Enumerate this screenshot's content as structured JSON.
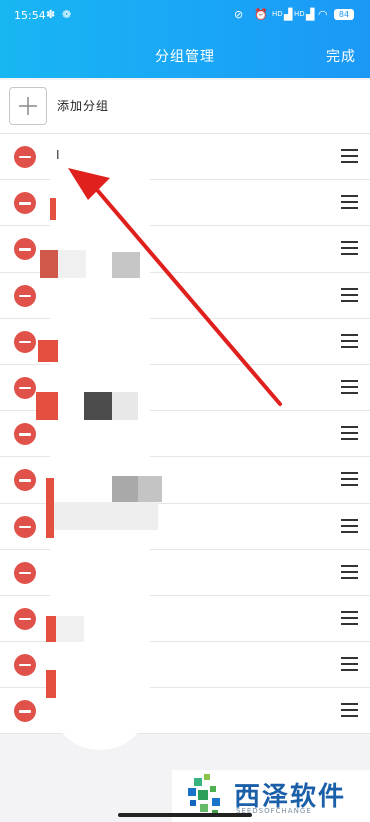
{
  "status_bar": {
    "time": "15:54",
    "network_1": "HD",
    "network_2": "HD",
    "battery": "84"
  },
  "header": {
    "title": "分组管理",
    "done_label": "完成"
  },
  "add_group": {
    "label": "添加分组"
  },
  "groups": [
    {
      "name": "I"
    },
    {
      "name": ""
    },
    {
      "name": ""
    },
    {
      "name": ""
    },
    {
      "name": ""
    },
    {
      "name": ""
    },
    {
      "name": ""
    },
    {
      "name": ""
    },
    {
      "name": ""
    },
    {
      "name": ""
    },
    {
      "name": ""
    },
    {
      "name": ""
    },
    {
      "name": ""
    }
  ],
  "watermark": {
    "brand": "西泽软件",
    "sub": "SEEDSOFCHANGE"
  },
  "colors": {
    "header_blue": "#1aa6f6",
    "delete_red": "#e0514a",
    "annotation_arrow": "#e0201c"
  }
}
